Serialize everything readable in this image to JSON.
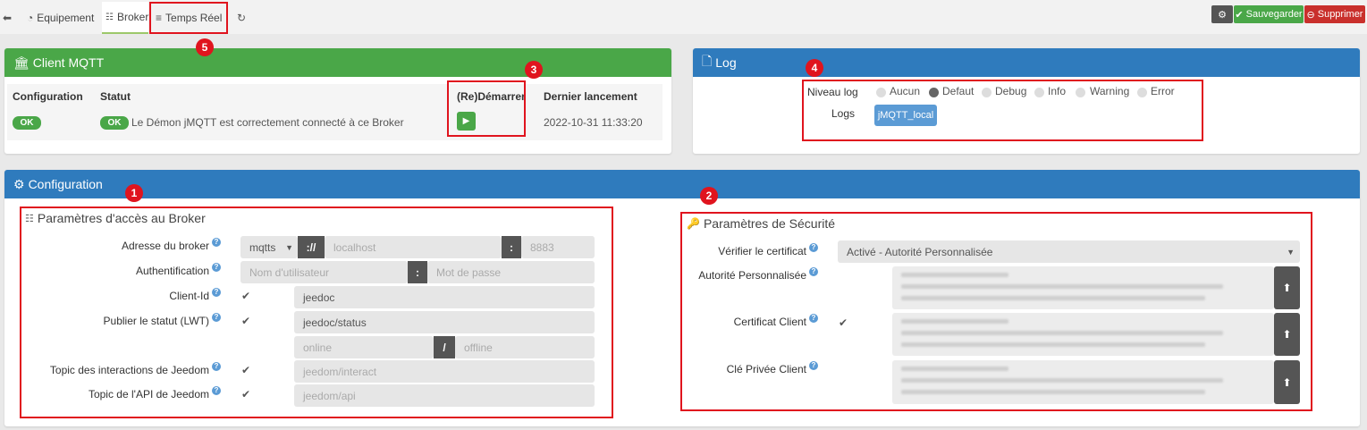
{
  "tabs": {
    "back_icon": "arrow-left-circle-icon",
    "equipement": "Equipement",
    "broker": "Broker",
    "temps_reel": "Temps Réel",
    "refresh_icon": "refresh-icon"
  },
  "actions": {
    "settings_icon": "cogs-icon",
    "save": "Sauvegarder",
    "delete": "Supprimer",
    "save_color": "#4aa748",
    "delete_color": "#c9302c"
  },
  "client_mqtt": {
    "title": "Client MQTT",
    "headers": {
      "configuration": "Configuration",
      "statut": "Statut",
      "restart": "(Re)Démarrer",
      "last_launch": "Dernier lancement"
    },
    "config_badge": "OK",
    "status_badge": "OK",
    "status_text": "Le Démon jMQTT est correctement connecté à ce Broker",
    "last_launch_value": "2022-10-31 11:33:20"
  },
  "log": {
    "title": "Log",
    "level_label": "Niveau log",
    "levels": [
      "Aucun",
      "Defaut",
      "Debug",
      "Info",
      "Warning",
      "Error"
    ],
    "selected_level": "Defaut",
    "logs_label": "Logs",
    "log_button": "jMQTT_local"
  },
  "configuration": {
    "title": "Configuration",
    "access": {
      "title": "Paramètres d'accès au Broker",
      "broker_address_label": "Adresse du broker",
      "protocol": "mqtts",
      "protocol_sep": "://",
      "host_placeholder": "localhost",
      "port_sep": ":",
      "port_placeholder": "8883",
      "auth_label": "Authentification",
      "user_placeholder": "Nom d'utilisateur",
      "auth_sep": ":",
      "password_placeholder": "Mot de passe",
      "client_id_label": "Client-Id",
      "client_id_value": "jeedoc",
      "lwt_label": "Publier le statut (LWT)",
      "lwt_value": "jeedoc/status",
      "online_placeholder": "online",
      "lwt_sep": "/",
      "offline_placeholder": "offline",
      "interact_label": "Topic des interactions de Jeedom",
      "interact_placeholder": "jeedom/interact",
      "api_label": "Topic de l'API de Jeedom",
      "api_placeholder": "jeedom/api"
    },
    "security": {
      "title": "Paramètres de Sécurité",
      "verify_label": "Vérifier le certificat",
      "verify_value": "Activé - Autorité Personnalisée",
      "ca_label": "Autorité Personnalisée",
      "client_cert_label": "Certificat Client",
      "private_key_label": "Clé Privée Client"
    }
  },
  "markers": [
    "1",
    "2",
    "3",
    "4",
    "5"
  ],
  "colors": {
    "annotation_red": "#e0141e",
    "header_green": "#4aa748",
    "header_blue": "#2f7bbd"
  }
}
